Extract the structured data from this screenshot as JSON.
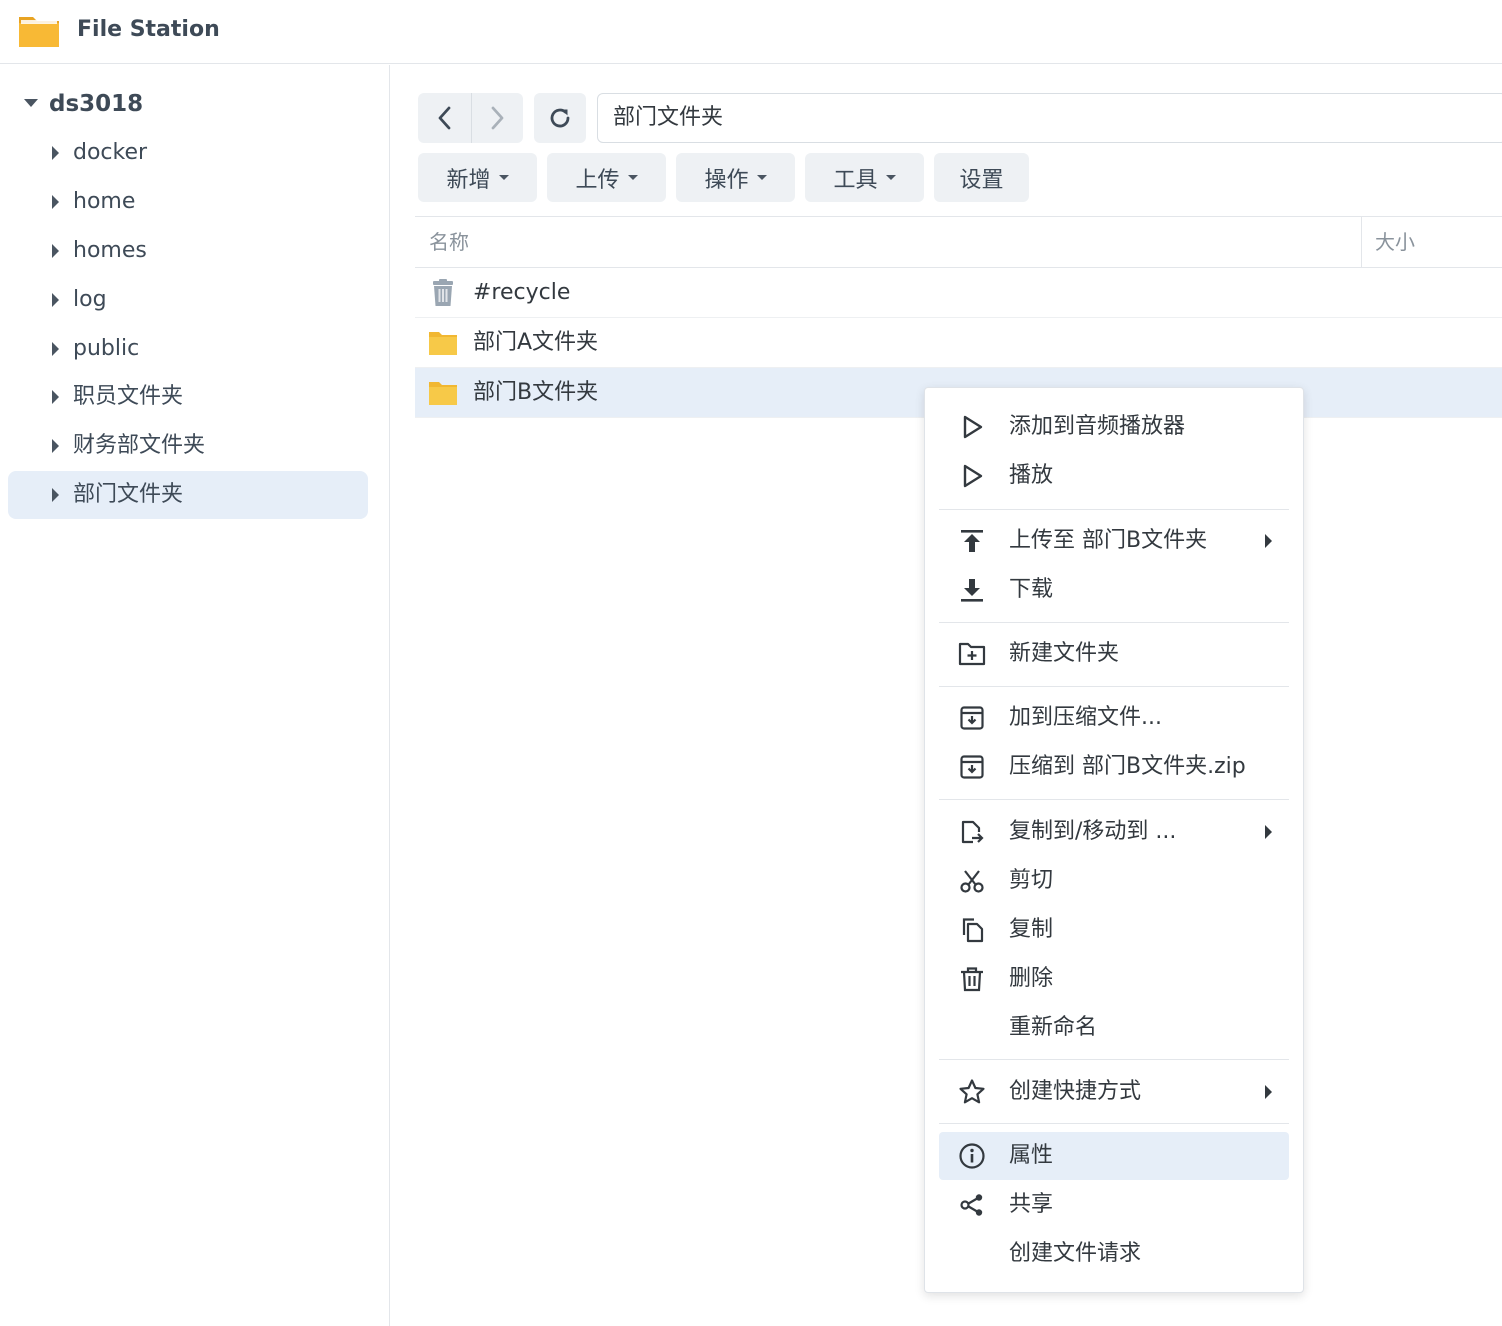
{
  "app": {
    "title": "File Station",
    "icon": "folder-icon"
  },
  "sidebar": {
    "root": "ds3018",
    "items": [
      {
        "label": "docker"
      },
      {
        "label": "home"
      },
      {
        "label": "homes"
      },
      {
        "label": "log"
      },
      {
        "label": "public"
      },
      {
        "label": "职员文件夹"
      },
      {
        "label": "财务部文件夹"
      },
      {
        "label": "部门文件夹",
        "selected": true
      }
    ]
  },
  "toolbar": {
    "path": "部门文件夹",
    "buttons": [
      {
        "label": "新增",
        "dropdown": true
      },
      {
        "label": "上传",
        "dropdown": true
      },
      {
        "label": "操作",
        "dropdown": true
      },
      {
        "label": "工具",
        "dropdown": true
      },
      {
        "label": "设置",
        "dropdown": false
      }
    ]
  },
  "file_list": {
    "columns": [
      "名称",
      "大小"
    ],
    "rows": [
      {
        "name": "#recycle",
        "icon": "trash-icon"
      },
      {
        "name": "部门A文件夹",
        "icon": "folder-icon"
      },
      {
        "name": "部门B文件夹",
        "icon": "folder-icon",
        "selected": true
      }
    ]
  },
  "context_menu": {
    "items": [
      {
        "label": "添加到音频播放器",
        "icon": "play-icon"
      },
      {
        "label": "播放",
        "icon": "play-icon"
      },
      {
        "label": "上传至 部门B文件夹",
        "icon": "upload-icon",
        "submenu": true
      },
      {
        "label": "下载",
        "icon": "download-icon"
      },
      {
        "label": "新建文件夹",
        "icon": "new-folder-icon"
      },
      {
        "label": "加到压缩文件...",
        "icon": "archive-icon"
      },
      {
        "label": "压缩到 部门B文件夹.zip",
        "icon": "archive-icon"
      },
      {
        "label": "复制到/移动到 ...",
        "icon": "copy-move-icon",
        "submenu": true
      },
      {
        "label": "剪切",
        "icon": "scissors-icon"
      },
      {
        "label": "复制",
        "icon": "copy-icon"
      },
      {
        "label": "删除",
        "icon": "trash-icon"
      },
      {
        "label": "重新命名",
        "icon": ""
      },
      {
        "label": "创建快捷方式",
        "icon": "star-icon",
        "submenu": true
      },
      {
        "label": "属性",
        "icon": "info-icon",
        "highlighted": true
      },
      {
        "label": "共享",
        "icon": "share-icon"
      },
      {
        "label": "创建文件请求",
        "icon": ""
      }
    ]
  },
  "colors": {
    "selection": "#e6eef8",
    "button_bg": "#eef1f4",
    "folder": "#f7c948",
    "text": "#33393f"
  }
}
